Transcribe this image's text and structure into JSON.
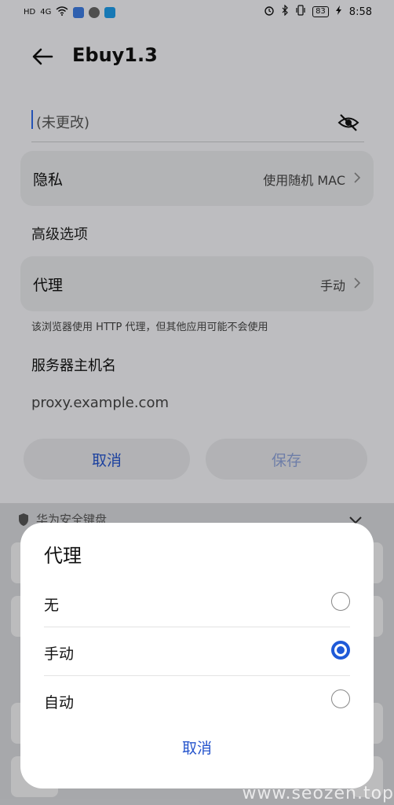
{
  "status_bar": {
    "left_labels": [
      "HD",
      "4G"
    ],
    "time": "8:58",
    "battery": "83"
  },
  "header": {
    "title": "Ebuy1.3"
  },
  "password": {
    "value": "(未更改)"
  },
  "privacy": {
    "label": "隐私",
    "value": "使用随机 MAC"
  },
  "advanced": {
    "label": "高级选项"
  },
  "proxy": {
    "label": "代理",
    "value": "手动",
    "hint": "该浏览器使用 HTTP 代理，但其他应用可能不会使用"
  },
  "hostname": {
    "label": "服务器主机名",
    "value": "proxy.example.com"
  },
  "buttons": {
    "cancel": "取消",
    "save": "保存"
  },
  "keyboard": {
    "title": "华为安全键盘"
  },
  "dialog": {
    "title": "代理",
    "options": [
      {
        "label": "无",
        "selected": false
      },
      {
        "label": "手动",
        "selected": true
      },
      {
        "label": "自动",
        "selected": false
      }
    ],
    "cancel": "取消"
  },
  "watermark": "www.seozen.top",
  "colors": {
    "accent": "#1f5ad8",
    "link": "#2554cc"
  }
}
